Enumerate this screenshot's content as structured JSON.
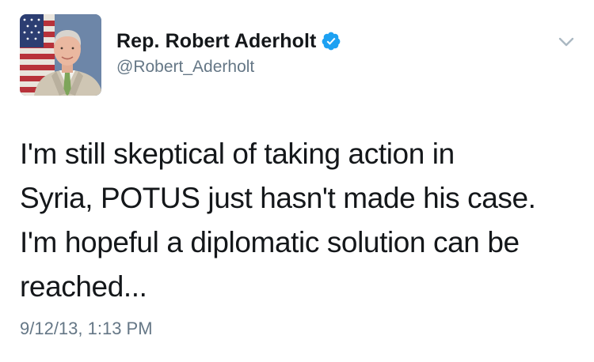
{
  "tweet": {
    "author": {
      "display_name": "Rep. Robert Aderholt",
      "handle": "@Robert_Aderholt",
      "verified": true,
      "avatar": "portrait-photo-with-american-flag"
    },
    "text_lines": [
      "I'm still skeptical of taking action in",
      "Syria, POTUS just hasn't made his case.",
      "I'm hopeful a diplomatic solution can be",
      "reached..."
    ],
    "timestamp": "9/12/13, 1:13 PM"
  },
  "icons": {
    "verified": "verified-badge-icon",
    "more_menu": "chevron-down-icon"
  },
  "colors": {
    "text_primary": "#14171a",
    "text_secondary": "#657786",
    "verified_blue": "#1da1f2",
    "chevron_gray": "#aab8c2",
    "background": "#ffffff"
  }
}
